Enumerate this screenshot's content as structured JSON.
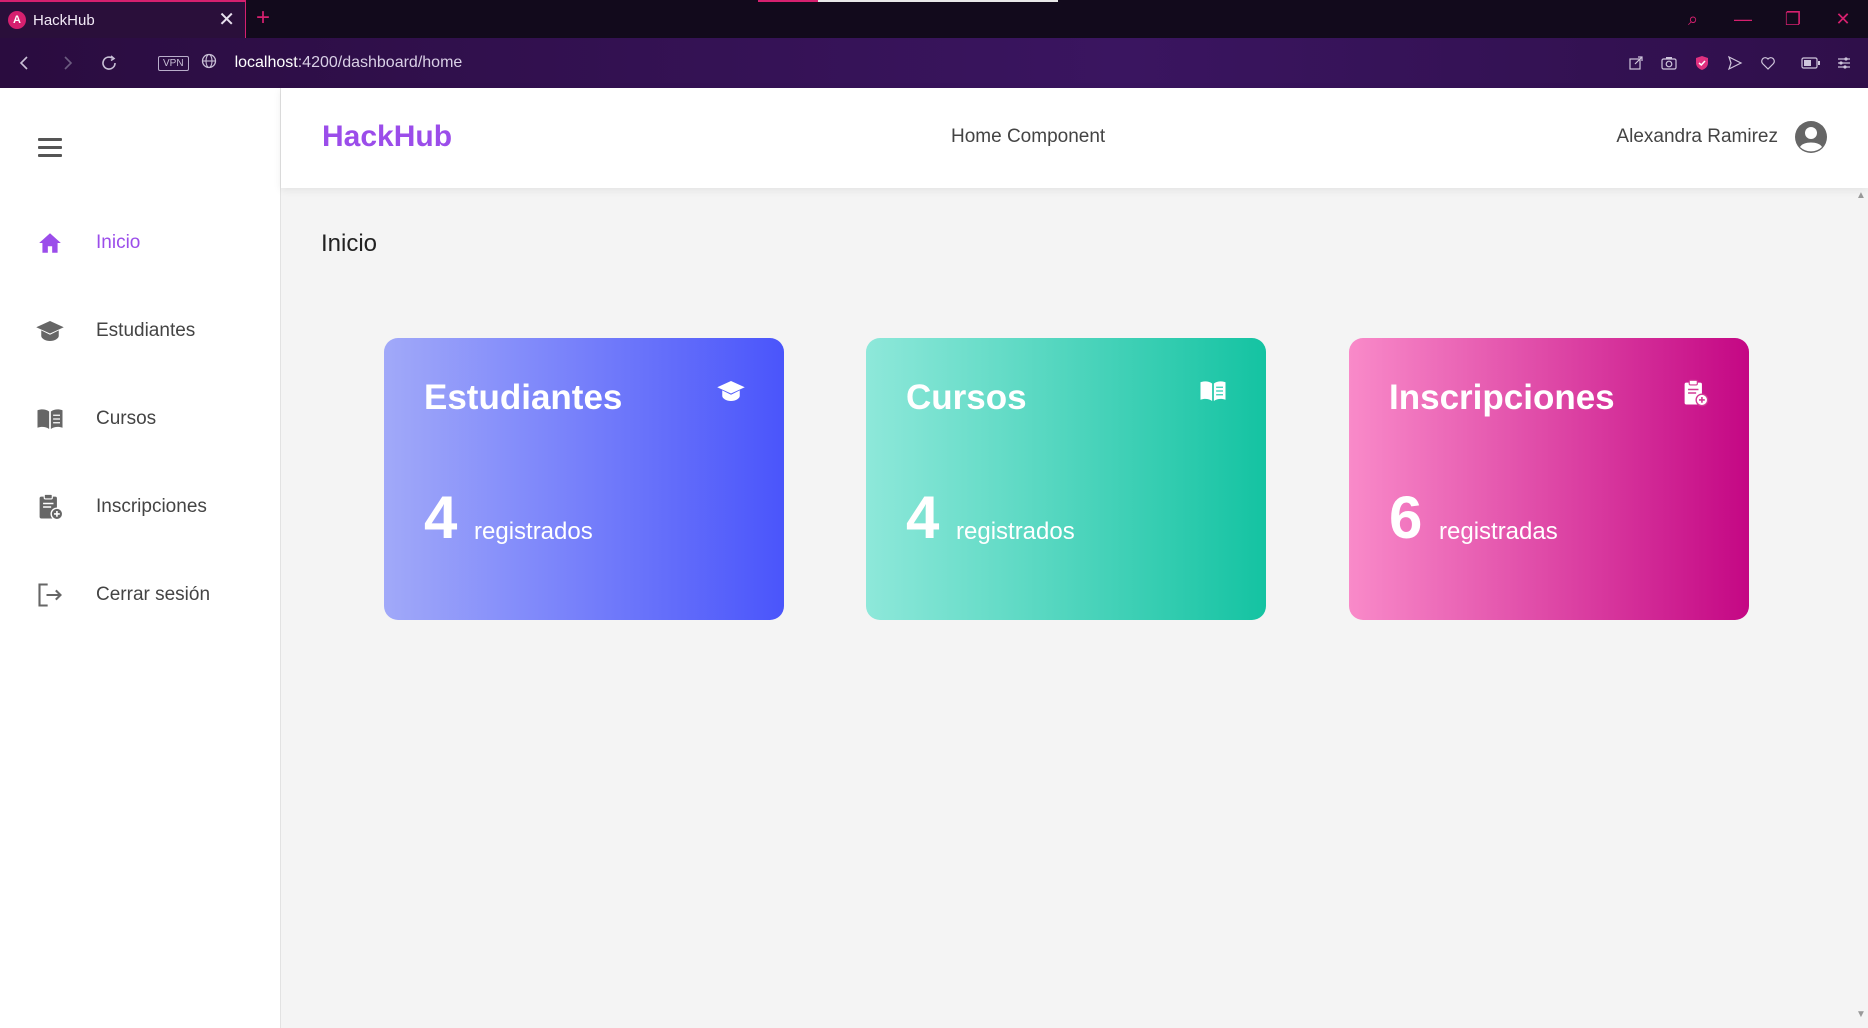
{
  "browser": {
    "tab_title": "HackHub",
    "tab_favicon_letter": "A",
    "tab_close": "✕",
    "new_tab": "+",
    "vpn_label": "VPN",
    "url_host": "localhost",
    "url_path": ":4200/dashboard/home",
    "window_controls": {
      "search": "⌕",
      "minimize": "—",
      "restore": "❐",
      "close": "✕"
    },
    "accent_color": "#d6206f"
  },
  "app": {
    "brand": "HackHub",
    "component_title": "Home Component",
    "user_name": "Alexandra Ramirez",
    "brand_color": "#9b4dea"
  },
  "sidebar": {
    "items": [
      {
        "label": "Inicio",
        "icon": "home-icon",
        "active": true
      },
      {
        "label": "Estudiantes",
        "icon": "graduation-cap-icon",
        "active": false
      },
      {
        "label": "Cursos",
        "icon": "book-icon",
        "active": false
      },
      {
        "label": "Inscripciones",
        "icon": "clipboard-add-icon",
        "active": false
      },
      {
        "label": "Cerrar sesión",
        "icon": "logout-icon",
        "active": false
      }
    ]
  },
  "page": {
    "title": "Inicio"
  },
  "cards": [
    {
      "title": "Estudiantes",
      "count": "4",
      "unit": "registrados",
      "icon": "graduation-cap-icon",
      "gradient": [
        "#a1a9f9",
        "#4a55fb"
      ]
    },
    {
      "title": "Cursos",
      "count": "4",
      "unit": "registrados",
      "icon": "book-icon",
      "gradient": [
        "#8ee8da",
        "#14c3a2"
      ]
    },
    {
      "title": "Inscripciones",
      "count": "6",
      "unit": "registradas",
      "icon": "clipboard-add-icon",
      "gradient": [
        "#f98ac9",
        "#c40784"
      ]
    }
  ]
}
